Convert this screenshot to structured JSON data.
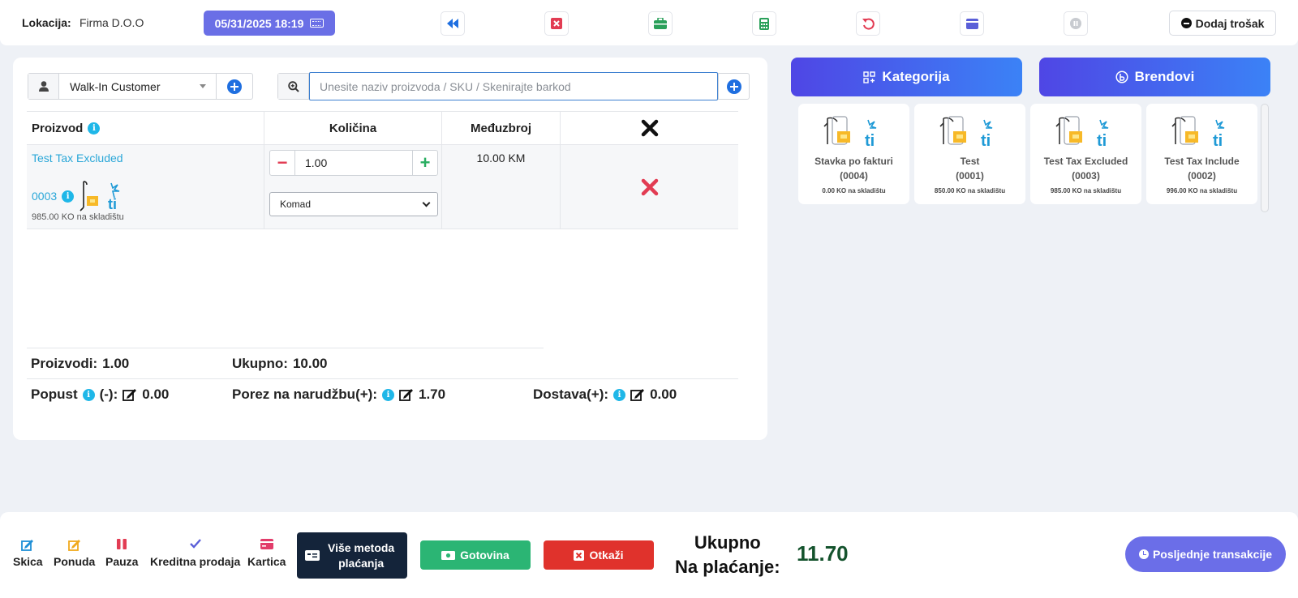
{
  "header": {
    "location_label": "Lokacija:",
    "location_value": "Firma D.O.O",
    "datetime": "05/31/2025 18:19",
    "add_expense_label": "Dodaj trošak"
  },
  "customer": {
    "selected": "Walk-In Customer"
  },
  "search": {
    "placeholder": "Unesite naziv proizvoda / SKU / Skenirajte barkod"
  },
  "table": {
    "headers": {
      "product": "Proizvod",
      "quantity": "Količina",
      "subtotal": "Međuzbroj"
    },
    "rows": [
      {
        "name": "Test Tax Excluded",
        "sku": "0003",
        "stock": "985.00 KO na skladištu",
        "quantity": "1.00",
        "unit": "Komad",
        "subtotal": "10.00 KM"
      }
    ]
  },
  "summary": {
    "products_label": "Proizvodi:",
    "products_value": "1.00",
    "total_label": "Ukupno:",
    "total_value": "10.00",
    "discount_label": "Popust",
    "discount_sign": "(-):",
    "discount_value": "0.00",
    "order_tax_label": "Porez na narudžbu(+):",
    "order_tax_value": "1.70",
    "shipping_label": "Dostava(+):",
    "shipping_value": "0.00"
  },
  "filters": {
    "category_label": "Kategorija",
    "brands_label": "Brendovi"
  },
  "products": [
    {
      "name": "Stavka po fakturi",
      "code": "(0004)",
      "stock": "0.00 KO na skladištu"
    },
    {
      "name": "Test",
      "code": "(0001)",
      "stock": "850.00 KO na skladištu"
    },
    {
      "name": "Test Tax Excluded",
      "code": "(0003)",
      "stock": "985.00 KO na skladištu"
    },
    {
      "name": "Test Tax Include",
      "code": "(0002)",
      "stock": "996.00 KO na skladištu"
    }
  ],
  "footer": {
    "draft": "Skica",
    "quote": "Ponuda",
    "pause": "Pauza",
    "credit_sale": "Kreditna prodaja",
    "card": "Kartica",
    "multi_pay_line1": "Više metoda",
    "multi_pay_line2": "plaćanja",
    "cash": "Gotovina",
    "cancel": "Otkaži",
    "total_line1": "Ukupno",
    "total_line2": "Na plaćanje:",
    "total_value": "11.70",
    "recent": "Posljednje transakcije"
  },
  "colors": {
    "accent": "#6a6fe6",
    "cash": "#2bb574",
    "cancel": "#e0322c",
    "total": "#14532d",
    "dark_button": "#14243a"
  },
  "icons": [
    "keyboard-icon",
    "rewind-icon",
    "close-square-icon",
    "briefcase-icon",
    "calculator-icon",
    "undo-icon",
    "card-icon",
    "pause-circle-icon"
  ]
}
